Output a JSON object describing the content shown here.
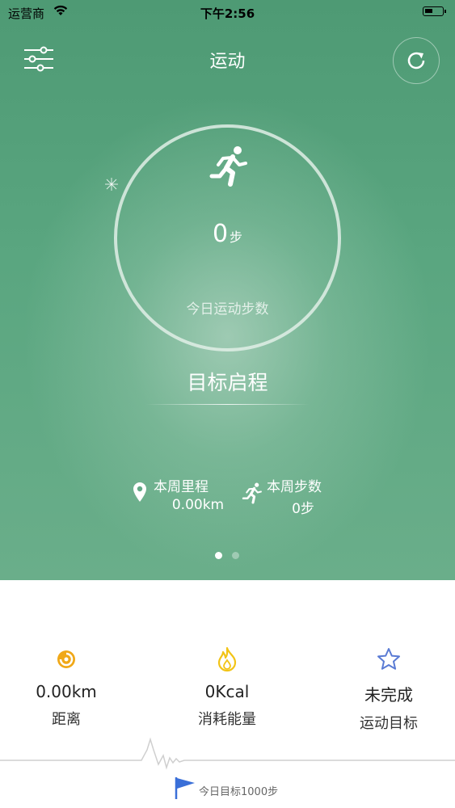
{
  "status_bar": {
    "carrier": "运营商",
    "time": "下午2:56",
    "battery_level": 0.45
  },
  "nav": {
    "title": "运动",
    "menu_icon": "sliders-icon",
    "refresh_icon": "refresh-icon"
  },
  "hero": {
    "step_count": "0",
    "step_unit": "步",
    "step_label": "今日运动步数",
    "goal_title": "目标启程",
    "week": {
      "mileage_label": "本周里程",
      "mileage_value": "0.00km",
      "steps_label": "本周步数",
      "steps_value": "0步"
    },
    "page_count": 2,
    "page_active": 1
  },
  "stats": [
    {
      "value": "0.00km",
      "label": "距离",
      "icon": "distance-icon",
      "color": "#f0a818"
    },
    {
      "value": "0Kcal",
      "label": "消耗能量",
      "icon": "flame-icon",
      "color": "#f2c417"
    },
    {
      "value": "未完成",
      "label": "运动目标",
      "icon": "star-icon",
      "color": "#5a7bd4"
    }
  ],
  "daily_target": {
    "text": "今日目标1000步",
    "icon": "flag-icon",
    "color": "#3a6fd8"
  },
  "colors": {
    "hero_green": "#4e9a74"
  }
}
